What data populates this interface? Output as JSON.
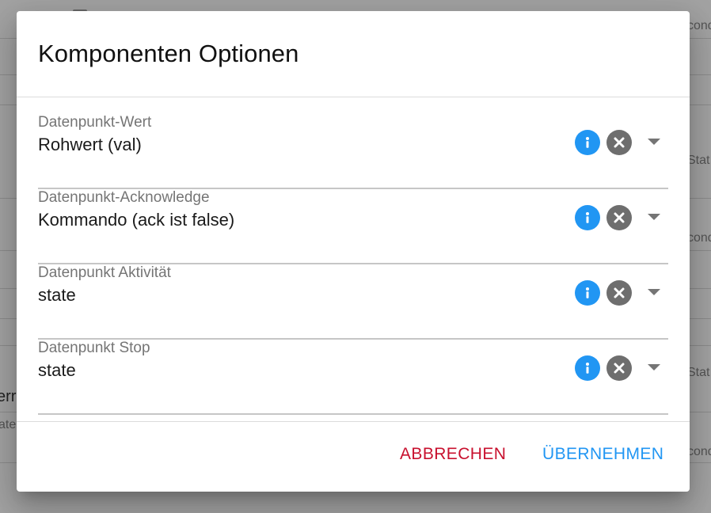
{
  "background": {
    "fragments": {
      "cond_top": "cond",
      "stat_1": "Stat",
      "cond_mid": "cond",
      "err_left": "err",
      "ate_left": "ate",
      "stat_2": "Stat",
      "cond_bottom": "cond"
    }
  },
  "dialog": {
    "title": "Komponenten Optionen",
    "fields": [
      {
        "label": "Datenpunkt-Wert",
        "value": "Rohwert (val)"
      },
      {
        "label": "Datenpunkt-Acknowledge",
        "value": "Kommando (ack ist false)"
      },
      {
        "label": "Datenpunkt Aktivität",
        "value": "state"
      },
      {
        "label": "Datenpunkt Stop",
        "value": "state"
      }
    ],
    "actions": {
      "cancel_label": "ABBRECHEN",
      "apply_label": "ÜBERNEHMEN"
    }
  },
  "colors": {
    "accent": "#2196f3",
    "cancel": "#c8102e",
    "clear_icon": "#6e6e6e"
  },
  "icons": {
    "info": "info-icon",
    "clear": "close-icon",
    "dropdown": "chevron-down-icon"
  }
}
